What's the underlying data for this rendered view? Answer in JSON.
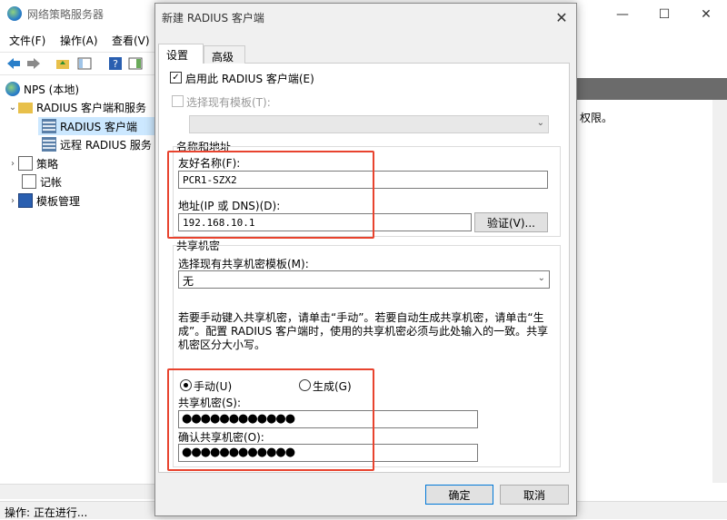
{
  "main_window": {
    "title": "网络策略服务器",
    "controls": {
      "minimize": "—",
      "maximize": "☐",
      "close": "✕"
    },
    "menu": [
      "文件(F)",
      "操作(A)",
      "查看(V)"
    ],
    "tree": {
      "root": "NPS (本地)",
      "radius_clients_servers": "RADIUS 客户端和服务",
      "radius_clients": "RADIUS 客户端",
      "remote_radius": "远程 RADIUS 服务",
      "policies": "策略",
      "accounting": "记帐",
      "template_mgmt": "模板管理"
    },
    "right_text": "权限。",
    "status": "操作:  正在进行..."
  },
  "dialog": {
    "title": "新建 RADIUS 客户端",
    "close": "✕",
    "tabs": [
      "设置",
      "高级"
    ],
    "enable_label": "启用此 RADIUS 客户端(E)",
    "enable_checked": "✓",
    "template_label": "选择现有模板(T):",
    "name_group": "名称和地址",
    "friendly_label": "友好名称(F):",
    "friendly_value": "PCR1-SZX2",
    "address_label": "地址(IP 或 DNS)(D):",
    "address_value": "192.168.10.1",
    "verify_button": "验证(V)...",
    "secret_group": "共享机密",
    "secret_template_label": "选择现有共享机密模板(M):",
    "secret_template_value": "无",
    "description": "若要手动键入共享机密，请单击“手动”。若要自动生成共享机密，请单击“生成”。配置 RADIUS 客户端时，使用的共享机密必须与此处输入的一致。共享机密区分大小写。",
    "manual_label": "手动(U)",
    "generate_label": "生成(G)",
    "secret_label": "共享机密(S):",
    "secret_value": "●●●●●●●●●●●●",
    "confirm_label": "确认共享机密(O):",
    "confirm_value": "●●●●●●●●●●●●",
    "ok_button": "确定",
    "cancel_button": "取消"
  },
  "colors": {
    "highlight": "#e8432e",
    "selection": "#cce8ff",
    "accent": "#0078d7"
  }
}
